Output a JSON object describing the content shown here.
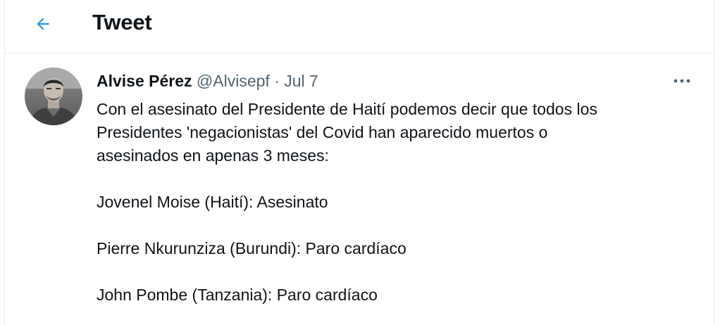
{
  "header": {
    "back_icon": "arrow-left-icon",
    "title": "Tweet"
  },
  "tweet": {
    "author": {
      "avatar_icon": "profile-photo",
      "name": "Alvise Pérez",
      "handle": "@Alvisepf",
      "separator": "·",
      "date": "Jul 7"
    },
    "more_icon": "more-options-icon",
    "text": {
      "intro_lines": [
        "Con el asesinato del Presidente de Haití podemos decir que todos los",
        "Presidentes 'negacionistas' del Covid han aparecido muertos o",
        "asesinados en apenas 3 meses:"
      ],
      "list": [
        "Jovenel Moise (Haití): Asesinato",
        "Pierre Nkurunziza (Burundi): Paro cardíaco",
        "John Pombe (Tanzania): Paro cardíaco"
      ]
    }
  },
  "colors": {
    "accent": "#1d9bf0",
    "text": "#0f1419",
    "secondary": "#536471",
    "border": "#e6ecf0"
  }
}
